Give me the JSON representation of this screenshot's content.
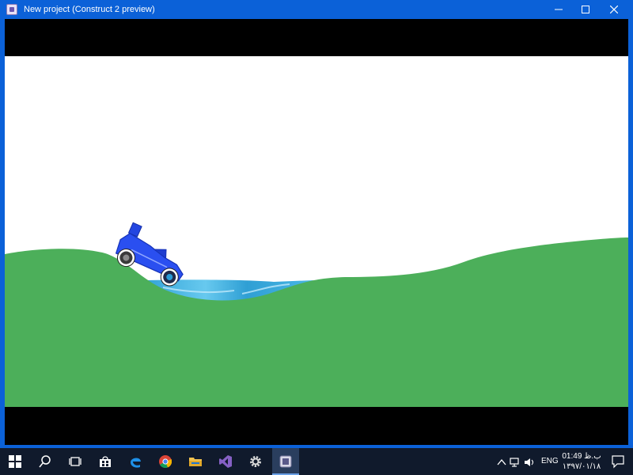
{
  "window": {
    "title": "New project (Construct 2 preview)",
    "icon": "construct-app-icon",
    "buttons": {
      "minimize": "minimize",
      "maximize": "maximize",
      "close": "close"
    }
  },
  "game": {
    "sky_color": "#ffffff",
    "ground_color": "#4caf5a",
    "water_color": "#2fa6d8",
    "car_color": "#2346e0",
    "letterbox_color": "#000000"
  },
  "taskbar": {
    "items": [
      {
        "name": "start-button",
        "icon": "windows-logo-icon"
      },
      {
        "name": "search-button",
        "icon": "search-icon"
      },
      {
        "name": "task-view-button",
        "icon": "task-view-icon"
      },
      {
        "name": "store-button",
        "icon": "store-icon"
      },
      {
        "name": "edge-button",
        "icon": "edge-icon"
      },
      {
        "name": "chrome-button",
        "icon": "chrome-icon"
      },
      {
        "name": "explorer-button",
        "icon": "folder-icon"
      },
      {
        "name": "visual-studio-button",
        "icon": "visual-studio-icon"
      },
      {
        "name": "settings-button",
        "icon": "gear-icon"
      },
      {
        "name": "construct-preview-button",
        "icon": "construct-app-icon"
      }
    ],
    "tray": {
      "language": "ENG",
      "time": "01:49 ب.ظ",
      "date": "۱۳۹۷/۰۱/۱۸"
    },
    "accent_color": "#6aa0e6"
  }
}
